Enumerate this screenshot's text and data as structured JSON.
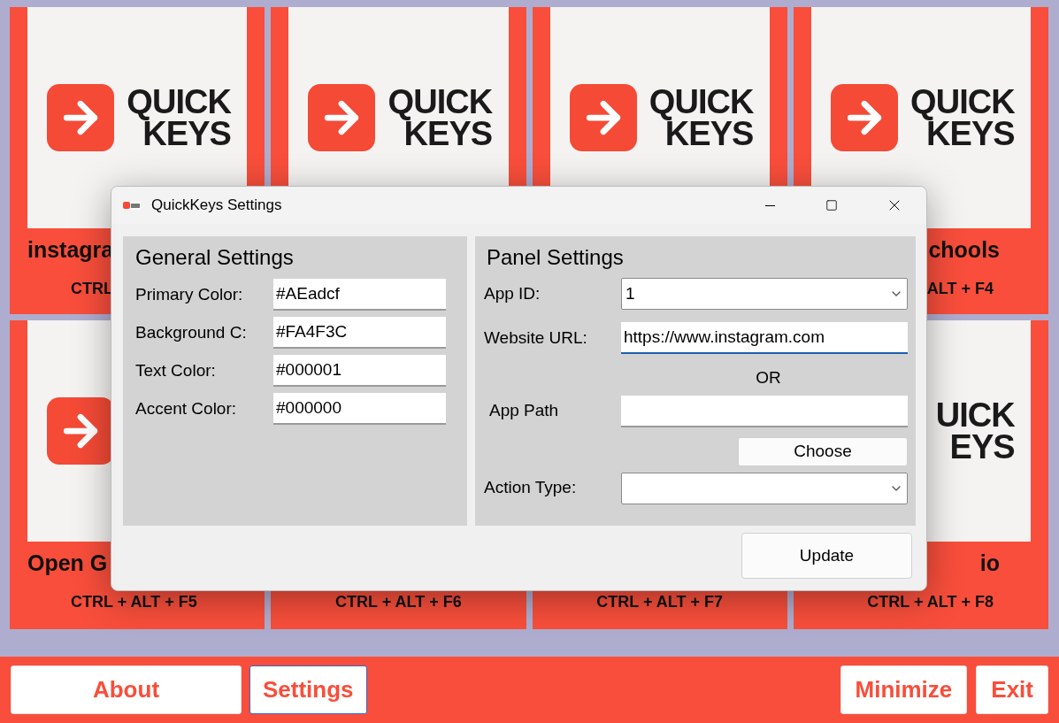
{
  "tiles": [
    {
      "kind": "start",
      "title": "instagra",
      "shortcut": "CTRL",
      "logo": {
        "icon": true,
        "lines": [
          "QUICK",
          "KEYS"
        ]
      }
    },
    {
      "kind": "center",
      "logo": {
        "icon": true,
        "lines": [
          "QUICK",
          "KEYS"
        ]
      }
    },
    {
      "kind": "center",
      "logo": {
        "icon": true,
        "lines": [
          "QUICK",
          "KEYS"
        ]
      }
    },
    {
      "kind": "end",
      "title": "chools",
      "shortcut": "ALT + F4",
      "logo": {
        "icon": true,
        "lines": [
          "QUICK",
          "KEYS"
        ]
      }
    },
    {
      "kind": "start",
      "title": "Open G",
      "shortcut": "CTRL + ALT + F5",
      "logo": {
        "icon": true
      }
    },
    {
      "kind": "center",
      "shortcut": "CTRL + ALT + F6"
    },
    {
      "kind": "center",
      "shortcut": "CTRL + ALT + F7"
    },
    {
      "kind": "end",
      "title": "io",
      "shortcut": "CTRL + ALT + F8",
      "logo": {
        "icon": false,
        "lines": [
          "UICK",
          "EYS"
        ]
      }
    }
  ],
  "dialog": {
    "title": "QuickKeys Settings",
    "general": {
      "heading": "General Settings",
      "fields": [
        {
          "label": "Primary Color:",
          "value": "#AEadcf"
        },
        {
          "label": "Background C:",
          "value": "#FA4F3C"
        },
        {
          "label": "Text Color:",
          "value": "#000001"
        },
        {
          "label": "Accent Color:",
          "value": "#000000"
        }
      ]
    },
    "panel": {
      "heading": "Panel Settings",
      "app_id": {
        "label": "App ID:",
        "value": "1"
      },
      "website_url": {
        "label": "Website URL:",
        "value": "https://www.instagram.com",
        "focused": true
      },
      "separator": "OR",
      "app_path": {
        "label": "App Path"
      },
      "choose_button": "Choose",
      "action_type": {
        "label": "Action Type:"
      }
    },
    "update_button": "Update"
  },
  "bottom_bar": {
    "left": [
      {
        "label": "About",
        "selected": false
      },
      {
        "label": "Settings",
        "selected": true
      }
    ],
    "right": [
      {
        "label": "Minimize",
        "selected": false
      },
      {
        "label": "Exit",
        "selected": false
      }
    ]
  }
}
